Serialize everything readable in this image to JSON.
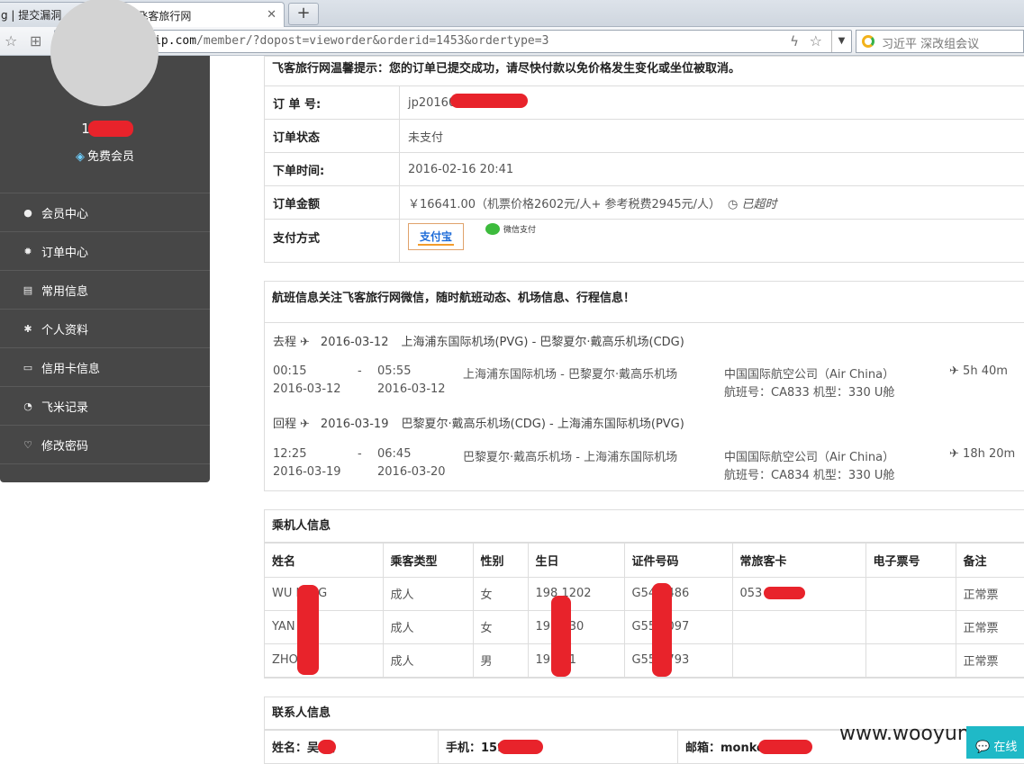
{
  "browser": {
    "tabs": [
      {
        "label": "g | 提交漏洞"
      },
      {
        "label": "-飞客旅行网"
      }
    ],
    "url_host": "www.flyertrip.com",
    "url_path": "/member/?dopost=vieworder&orderid=1453&ordertype=3",
    "search_query": "习近平  深改组会议"
  },
  "sidebar": {
    "phone": "138      66",
    "member_level": "免费会员",
    "menu": [
      {
        "label": "会员中心",
        "icon": "user-icon"
      },
      {
        "label": "订单中心",
        "icon": "gear-icon"
      },
      {
        "label": "常用信息",
        "icon": "list-icon"
      },
      {
        "label": "个人资料",
        "icon": "asterisk-icon"
      },
      {
        "label": "信用卡信息",
        "icon": "credit-card-icon"
      },
      {
        "label": "飞米记录",
        "icon": "clock-icon"
      },
      {
        "label": "修改密码",
        "icon": "heart-icon"
      }
    ]
  },
  "order": {
    "notice": "飞客旅行网温馨提示：您的订单已提交成功，请尽快付款以免价格发生变化或坐位被取消。",
    "rows": [
      {
        "label": "订 单 号:",
        "value": "jp20160          00584924"
      },
      {
        "label": "订单状态",
        "value": "未支付"
      },
      {
        "label": "下单时间:",
        "value": "2016-02-16 20:41"
      },
      {
        "label": "订单金额",
        "value": "￥16641.00（机票价格2602元/人+ 参考税费2945元/人）"
      }
    ],
    "overdue": "已超时",
    "payment_label": "支付方式",
    "alipay_label": "支付宝",
    "wechat_label": "微信支付"
  },
  "flights": {
    "heading": "航班信息关注飞客旅行网微信，随时航班动态、机场信息、行程信息！",
    "legs": [
      {
        "direction": "去程",
        "date": "2016-03-12",
        "route": "上海浦东国际机场(PVG)  - 巴黎夏尔·戴高乐机场(CDG)",
        "dep_time": "00:15",
        "dep_date": "2016-03-12",
        "dash": "-",
        "arr_time": "05:55",
        "arr_date": "2016-03-12",
        "airports": "上海浦东国际机场 - 巴黎夏尔·戴高乐机场",
        "airline": "中国国际航空公司（Air China）",
        "detail": "航班号：CA833    机型：330    U舱",
        "duration": "5h 40m"
      },
      {
        "direction": "回程",
        "date": "2016-03-19",
        "route": "巴黎夏尔·戴高乐机场(CDG)  - 上海浦东国际机场(PVG)",
        "dep_time": "12:25",
        "dep_date": "2016-03-19",
        "dash": "-",
        "arr_time": "06:45",
        "arr_date": "2016-03-20",
        "airports": "巴黎夏尔·戴高乐机场 - 上海浦东国际机场",
        "airline": "中国国际航空公司（Air China）",
        "detail": "航班号：CA834    机型：330    U舱",
        "duration": "18h 20m"
      }
    ]
  },
  "passengers": {
    "heading": "乘机人信息",
    "columns": [
      "姓名",
      "乘客类型",
      "性别",
      "生日",
      "证件号码",
      "常旅客卡",
      "电子票号",
      "备注"
    ],
    "rows": [
      [
        "WU    ILING",
        "成人",
        "女",
        "198  1202",
        "G54   3486",
        "053          287",
        "",
        "正常票"
      ],
      [
        "YAN    A",
        "成人",
        "女",
        "19   0130",
        "G55   7097",
        "",
        "",
        "正常票"
      ],
      [
        "ZHOU  I",
        "成人",
        "男",
        "19    201",
        "G55   3793",
        "",
        "",
        "正常票"
      ]
    ]
  },
  "contact": {
    "heading": "联系人信息",
    "name": "姓名：吴   凌",
    "mobile": "手机：159         573",
    "email": "邮箱：monke        3.com"
  },
  "watermark": "www.wooyun.org",
  "chat_button": "在线"
}
